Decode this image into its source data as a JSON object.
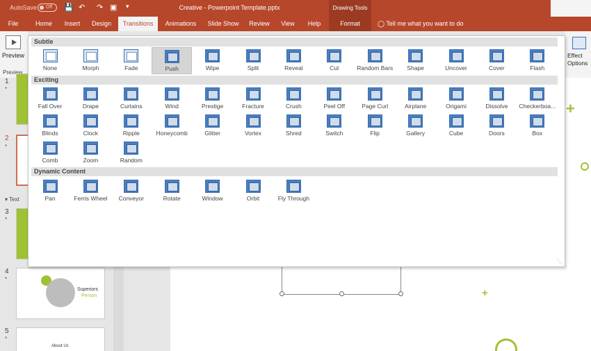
{
  "titlebar": {
    "autosave_label": "AutoSave",
    "autosave_state": "Off",
    "doc_title": "Creative - Powerpoint Template.pptx",
    "context_header": "Drawing Tools"
  },
  "tabs": [
    "File",
    "Home",
    "Insert",
    "Design",
    "Transitions",
    "Animations",
    "Slide Show",
    "Review",
    "View",
    "Help",
    "Format"
  ],
  "active_tab": "Transitions",
  "tell_me": "Tell me what you want to do",
  "ribbon": {
    "preview_label": "Preview",
    "preview_group": "Preview",
    "effect_options_label": "Effect Options"
  },
  "gallery": {
    "subtle_title": "Subtle",
    "subtle": [
      "None",
      "Morph",
      "Fade",
      "Push",
      "Wipe",
      "Split",
      "Reveal",
      "Cut",
      "Random Bars",
      "Shape",
      "Uncover",
      "Cover",
      "Flash"
    ],
    "exciting_title": "Exciting",
    "exciting": [
      "Fall Over",
      "Drape",
      "Curtains",
      "Wind",
      "Prestige",
      "Fracture",
      "Crush",
      "Peel Off",
      "Page Curl",
      "Airplane",
      "Origami",
      "Dissolve",
      "Checkerboa...",
      "Blinds",
      "Clock",
      "Ripple",
      "Honeycomb",
      "Glitter",
      "Vortex",
      "Shred",
      "Switch",
      "Flip",
      "Gallery",
      "Cube",
      "Doors",
      "Box",
      "Comb",
      "Zoom",
      "Random"
    ],
    "dynamic_title": "Dynamic Content",
    "dynamic": [
      "Pan",
      "Ferris Wheel",
      "Conveyor",
      "Rotate",
      "Window",
      "Orbit",
      "Fly Through"
    ],
    "selected": "Push"
  },
  "slides": {
    "numbers": [
      "1",
      "2",
      "3",
      "4",
      "5"
    ],
    "section_label": "Text",
    "thumb4_title": "Superiors",
    "thumb4_subtitle": "Person",
    "thumb5_title": "About Us"
  },
  "colors": {
    "accent": "#b7472a",
    "green": "#9fc234",
    "transition_blue": "#4a7ec0"
  }
}
